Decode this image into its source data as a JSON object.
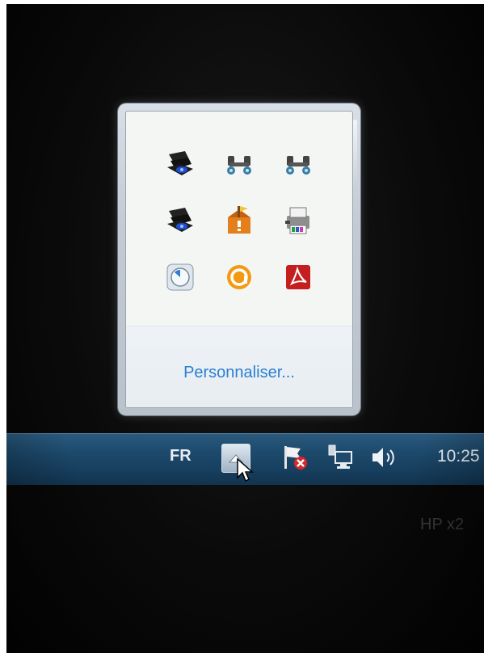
{
  "popup": {
    "icons": [
      {
        "name": "webcam-icon",
        "color": "#1b1b1b"
      },
      {
        "name": "bluetooth-network-icon",
        "color": "#2a6a8a"
      },
      {
        "name": "bluetooth-network-icon",
        "color": "#2a6a8a"
      },
      {
        "name": "webcam-icon",
        "color": "#1b1b1b"
      },
      {
        "name": "action-center-warning-icon",
        "color": "#e07a1a"
      },
      {
        "name": "printer-icon",
        "color": "#7a7a7a"
      },
      {
        "name": "clock-dial-icon",
        "color": "#c9d6e2"
      },
      {
        "name": "avast-icon",
        "color": "#f39a12"
      },
      {
        "name": "adobe-reader-icon",
        "color": "#c41e1e"
      }
    ],
    "customize_label": "Personnaliser..."
  },
  "taskbar": {
    "language": "FR",
    "clock": "10:25",
    "icons": [
      "show-hidden-icons-chevron-icon",
      "action-center-flag-icon",
      "network-icon",
      "volume-icon"
    ]
  },
  "monitor": {
    "brand": "HP x2"
  },
  "colors": {
    "taskbar": "#1d4a6c",
    "link": "#2a7fd0",
    "popup_bg": "#f4f6f3"
  }
}
